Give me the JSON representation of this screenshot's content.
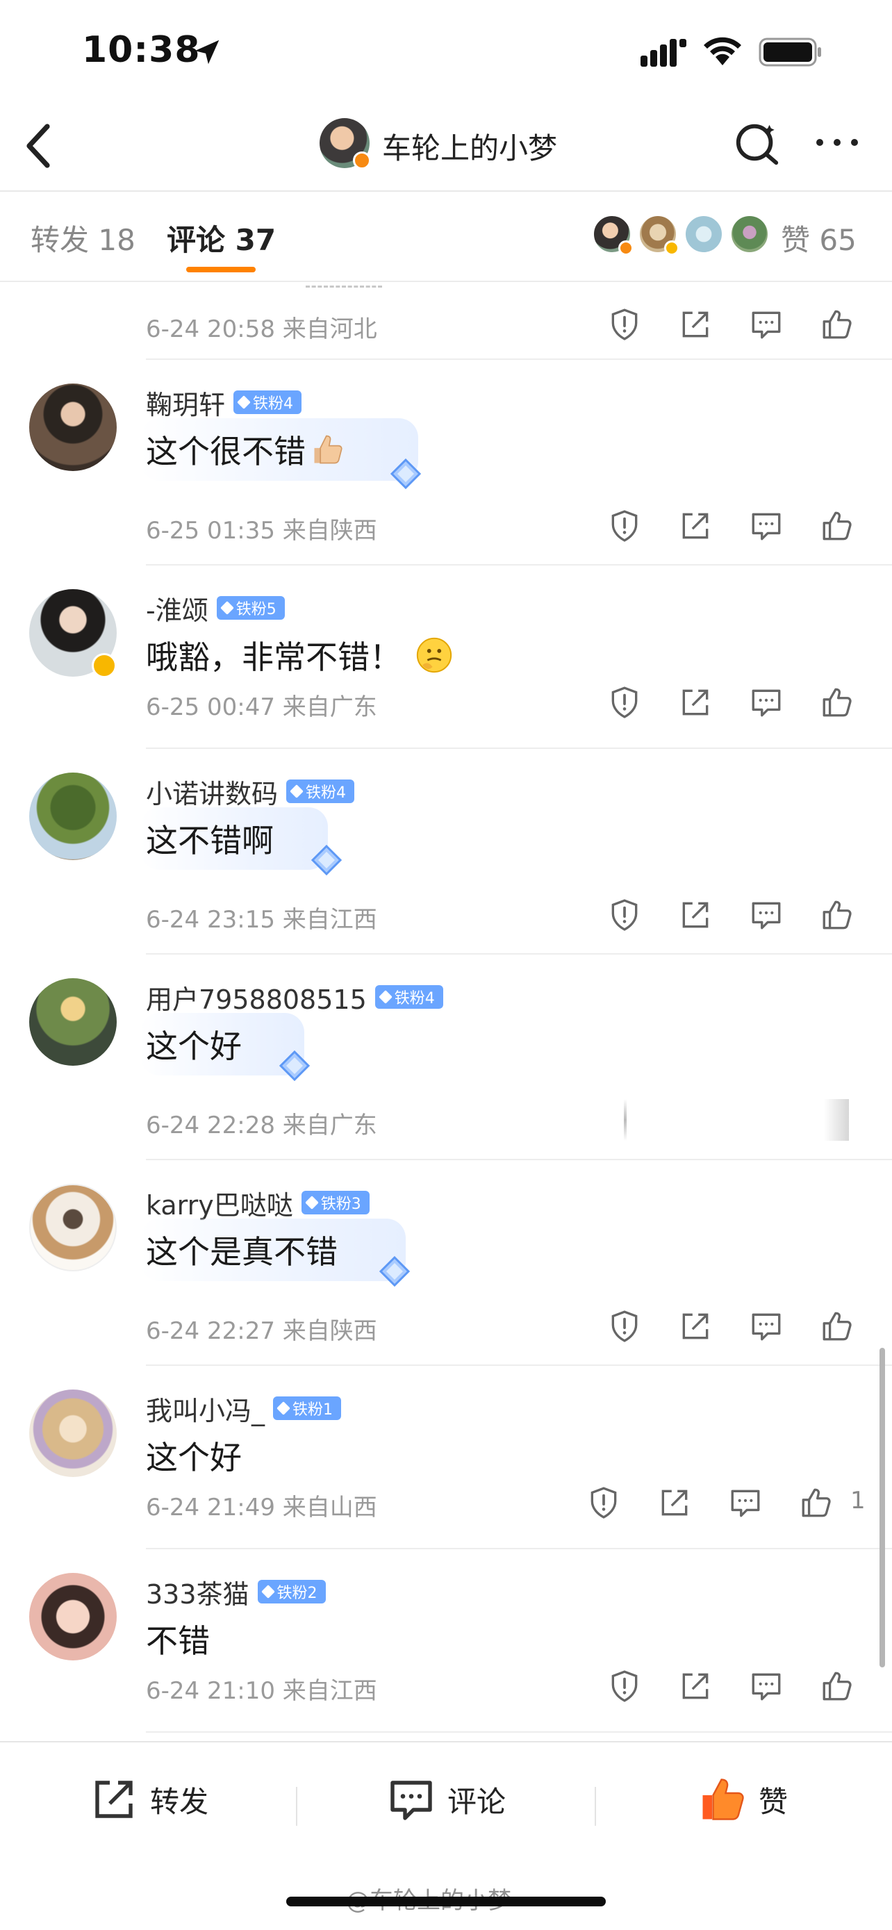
{
  "status_bar": {
    "time": "10:38"
  },
  "nav": {
    "title": "车轮上的小梦"
  },
  "tabs": {
    "repost": "转发 18",
    "comments": "评论 37",
    "likes": "赞 65"
  },
  "comments": [
    {
      "time_location": "6-24 20:58 来自河北"
    },
    {
      "name": "鞠玥轩",
      "badge": "铁粉4",
      "text": "这个很不错",
      "time_location": "6-25 01:35 来自陕西"
    },
    {
      "name": "-淮颂",
      "badge": "铁粉5",
      "text": "哦豁，非常不错！",
      "time_location": "6-25 00:47 来自广东"
    },
    {
      "name": "小诺讲数码",
      "badge": "铁粉4",
      "text": "这不错啊",
      "time_location": "6-24 23:15 来自江西"
    },
    {
      "name": "用户7958808515",
      "badge": "铁粉4",
      "text": "这个好",
      "time_location": "6-24 22:28 来自广东"
    },
    {
      "name": "karry巴哒哒",
      "badge": "铁粉3",
      "text": "这个是真不错",
      "time_location": "6-24 22:27 来自陕西"
    },
    {
      "name": "我叫小冯_",
      "badge": "铁粉1",
      "text": "这个好",
      "time_location": "6-24 21:49 来自山西",
      "like_count": "1"
    },
    {
      "name": "333茶猫",
      "badge": "铁粉2",
      "text": "不错",
      "time_location": "6-24 21:10 来自江西"
    }
  ],
  "bottom_bar": {
    "repost": "转发",
    "comment": "评论",
    "like": "赞"
  },
  "watermark": "@车轮上的小梦",
  "colors": {
    "accent": "#ff8200",
    "badge": "#6aa5ff",
    "like_active": "#ff6a2a"
  }
}
